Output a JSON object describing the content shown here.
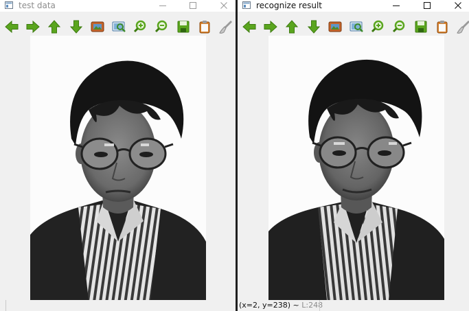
{
  "windows": [
    {
      "id": "left",
      "title": "test data",
      "active": false,
      "status": {
        "coords": "",
        "luminance": ""
      }
    },
    {
      "id": "right",
      "title": "recognize result",
      "active": true,
      "status": {
        "coords": "(x=2, y=238) ~ ",
        "luminance": "L:248"
      }
    }
  ],
  "toolbar_buttons": [
    {
      "name": "pan-left-button",
      "icon": "arrow-left-icon"
    },
    {
      "name": "pan-right-button",
      "icon": "arrow-right-icon"
    },
    {
      "name": "pan-up-button",
      "icon": "arrow-up-icon"
    },
    {
      "name": "pan-down-button",
      "icon": "arrow-down-icon"
    },
    {
      "name": "zoom-fit-button",
      "icon": "image-fit-icon"
    },
    {
      "name": "zoom-original-button",
      "icon": "zoom-image-icon"
    },
    {
      "name": "zoom-in-button",
      "icon": "zoom-in-icon"
    },
    {
      "name": "zoom-out-button",
      "icon": "zoom-out-icon"
    },
    {
      "name": "save-button",
      "icon": "floppy-disk-icon"
    },
    {
      "name": "copy-button",
      "icon": "clipboard-icon"
    },
    {
      "name": "properties-button",
      "icon": "brush-icon"
    }
  ],
  "window_controls": [
    "minimize-button",
    "maximize-button",
    "close-button"
  ],
  "colors": {
    "toolbar_green": "#5aa51e",
    "window_bg": "#f0f0f0",
    "titlebar_bg": "#ffffff",
    "inactive_title": "#8c8c8c"
  }
}
